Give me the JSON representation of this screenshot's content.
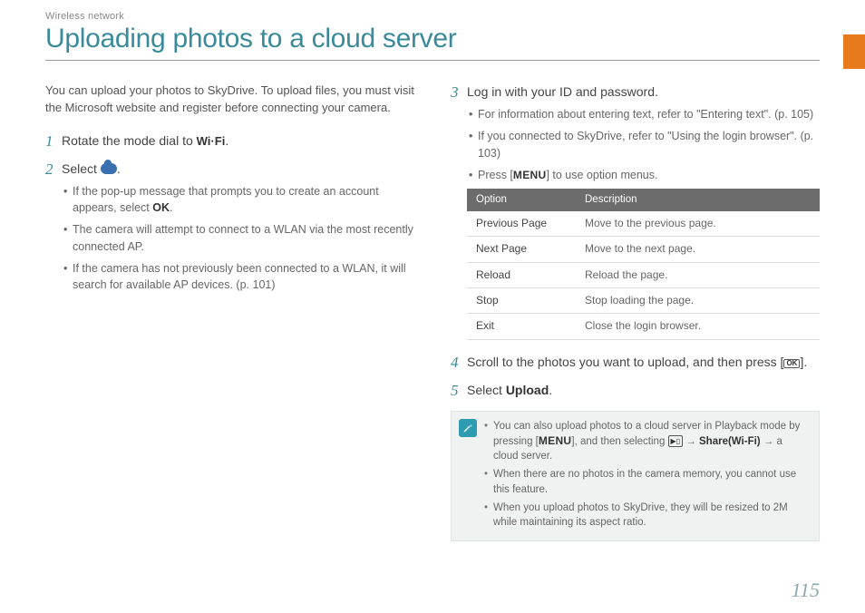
{
  "header": {
    "breadcrumb": "Wireless network",
    "title": "Uploading photos to a cloud server"
  },
  "left": {
    "intro": "You can upload your photos to SkyDrive. To upload files, you must visit the Microsoft website and register before connecting your camera.",
    "step1": {
      "num": "1",
      "pre": "Rotate the mode dial to ",
      "icon": "Wi·Fi",
      "post": "."
    },
    "step2": {
      "num": "2",
      "pre": "Select ",
      "post": ".",
      "bullets": [
        {
          "pre": "If the pop-up message that prompts you to create an account appears, select ",
          "bold": "OK",
          "post": "."
        },
        {
          "text": "The camera will attempt to connect to a WLAN via the most recently connected AP."
        },
        {
          "text": "If the camera has not previously been connected to a WLAN, it will search for available AP devices. (p. 101)"
        }
      ]
    }
  },
  "right": {
    "step3": {
      "num": "3",
      "title": "Log in with your ID and password.",
      "bullets": [
        {
          "text": "For information about entering text, refer to \"Entering text\". (p. 105)"
        },
        {
          "text": "If you connected to SkyDrive, refer to \"Using the login browser\". (p. 103)"
        },
        {
          "pre": "Press [",
          "menu": "MENU",
          "post": "] to use option menus."
        }
      ]
    },
    "table": {
      "headers": [
        "Option",
        "Description"
      ],
      "rows": [
        [
          "Previous Page",
          "Move to the previous page."
        ],
        [
          "Next Page",
          "Move to the next page."
        ],
        [
          "Reload",
          "Reload the page."
        ],
        [
          "Stop",
          "Stop loading the page."
        ],
        [
          "Exit",
          "Close the login browser."
        ]
      ]
    },
    "step4": {
      "num": "4",
      "pre": "Scroll to the photos you want to upload, and then press [",
      "ok": "OK",
      "post": "]."
    },
    "step5": {
      "num": "5",
      "pre": "Select ",
      "bold": "Upload",
      "post": "."
    },
    "note": [
      {
        "pre": "You can also upload photos to a cloud server in Playback mode by pressing [",
        "menu": "MENU",
        "mid1": "], and then selecting ",
        "share": "▶▯",
        "mid2": " → ",
        "bold": "Share(Wi-Fi)",
        "post": " → a cloud server."
      },
      {
        "text": "When there are no photos in the camera memory, you cannot use this feature."
      },
      {
        "text": "When you upload photos to SkyDrive, they will be resized to 2M while maintaining its aspect ratio."
      }
    ]
  },
  "page_number": "115"
}
